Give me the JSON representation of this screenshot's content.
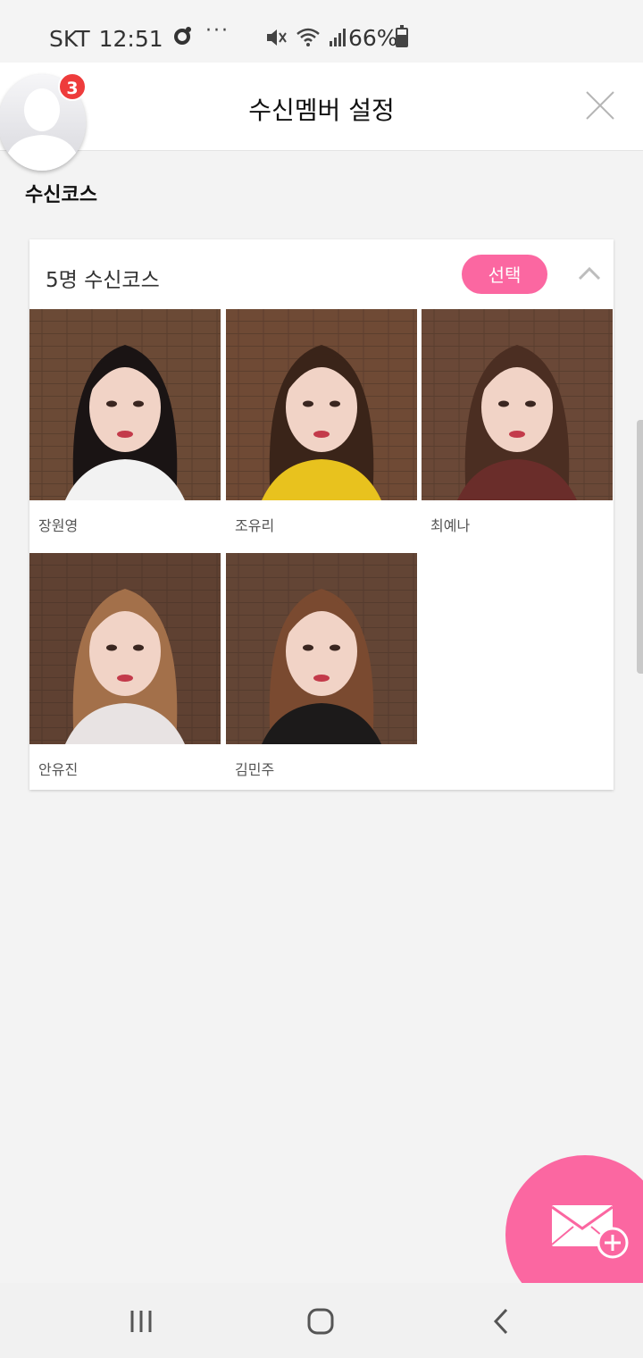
{
  "status_bar": {
    "carrier": "SKT",
    "time": "12:51",
    "dots": "···",
    "battery_text": "66%",
    "battery_level": 0.66
  },
  "header": {
    "title": "수신멤버 설정"
  },
  "profile": {
    "badge_count": "3",
    "label": "수신코스"
  },
  "course_card": {
    "title": "5명 수신코스",
    "select_label": "선택",
    "members": [
      {
        "name": "장원영",
        "bg": "#6b4a36",
        "hair": "#1a1414",
        "top": "#f2f2f2"
      },
      {
        "name": "조유리",
        "bg": "#6f4a35",
        "hair": "#3a2419",
        "top": "#e8c21e"
      },
      {
        "name": "최예나",
        "bg": "#6a4837",
        "hair": "#4b2e22",
        "top": "#6a2d2a"
      },
      {
        "name": "안유진",
        "bg": "#5f4132",
        "hair": "#a3704a",
        "top": "#e8e3e3"
      },
      {
        "name": "김민주",
        "bg": "#634535",
        "hair": "#7a4a30",
        "top": "#1c1a1a"
      }
    ]
  },
  "colors": {
    "accent": "#fb67a1",
    "badge": "#ee3c3c"
  }
}
